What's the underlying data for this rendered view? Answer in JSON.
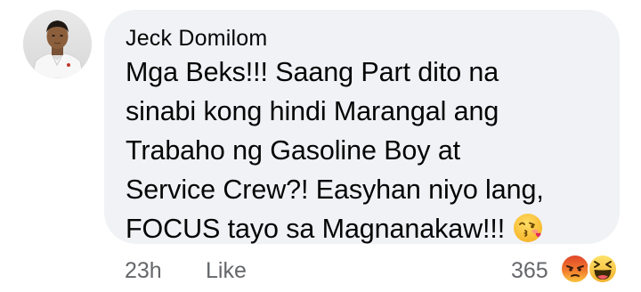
{
  "comment": {
    "author": "Jeck Domilom",
    "text_lines": [
      "Mga Beks!!! Saang Part dito na",
      "sinabi kong hindi Marangal ang",
      "Trabaho ng Gasoline Boy at",
      "Service Crew?! Easyhan niyo lang,",
      "FOCUS tayo sa Magnanakaw!!!"
    ],
    "trailing_emoji": "face-blowing-a-kiss",
    "timestamp": "23h",
    "like_label": "Like",
    "reaction_count": "365",
    "reactions": [
      "angry",
      "haha"
    ]
  },
  "colors": {
    "bubble": "#f0f2f5",
    "text": "#050505",
    "meta": "#65676b"
  }
}
